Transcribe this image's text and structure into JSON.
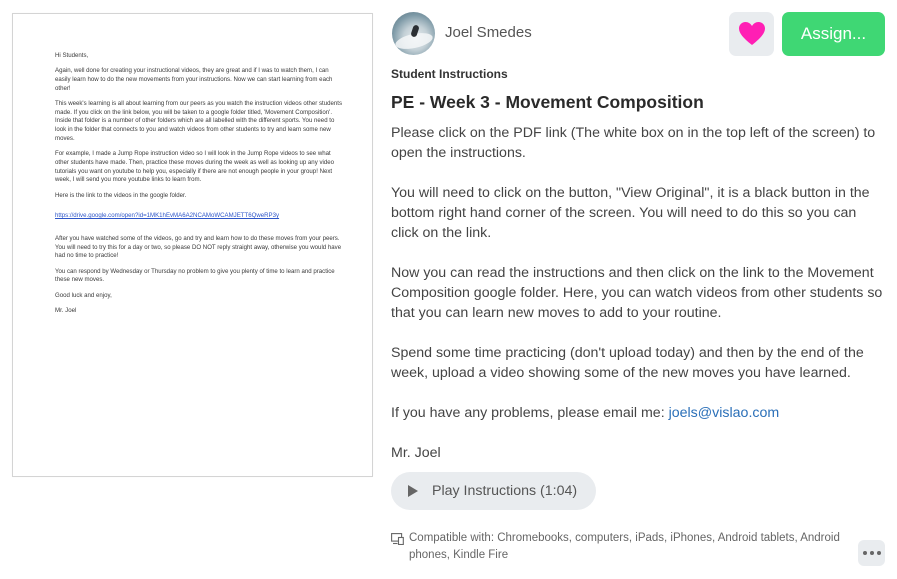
{
  "document": {
    "greeting": "Hi Students,",
    "paragraphs": [
      "Again, well done for creating your instructional videos, they are great and if I was to watch them, I can easily learn how to do the new movements from your instructions. Now we can start learning from each other!",
      "This week's learning is all about learning from our peers as you watch the instruction videos other students made. If you click on the link below, you will be taken to a google folder titled, 'Movement Composition'. Inside that folder is a number of other folders which are all labelled with the different sports. You need to look in the folder that connects to you and watch videos from other students to try and learn some new moves.",
      "For example, I made a Jump Rope instruction video so I will look in the Jump Rope videos to see what other students have made. Then, practice these moves during the week as well as looking up any video tutorials you want on youtube to help you, especially if there are not enough people in your group! Next week, I will send you more youtube links to learn from.",
      "Here is the link to the videos in the google folder."
    ],
    "link": "https://drive.google.com/open?id=1MK1hEvMA6A2NCAMoWCAMJETT6QweRP3y",
    "paragraphs_after": [
      "After you have watched some of the videos, go and try and learn how to do these moves from your peers. You will need to try this for a day or two, so please DO NOT reply straight away, otherwise you would have had no time to practice!",
      "You can respond by Wednesday or Thursday no problem to give you plenty of time to learn and practice these new moves.",
      "Good luck and enjoy,",
      "Mr. Joel"
    ]
  },
  "header": {
    "author_name": "Joel Smedes",
    "like_icon": "heart-icon",
    "like_color": "#ff1fb4",
    "assign_label": "Assign...",
    "assign_color": "#3fd774"
  },
  "instructions": {
    "section_label": "Student Instructions",
    "title": "PE - Week 3 - Movement Composition",
    "p1": "Please click on the PDF link (The white box on in the top left of the screen) to open the instructions.",
    "p2": "You will need to click on the button, \"View Original\", it is a black button in the bottom right hand corner of the screen. You will need to do this so you can click on the link.",
    "p3": "Now you can read the instructions and then click on the link to the Movement Composition google folder. Here, you can watch videos from other students so that you can learn new moves to add to your routine.",
    "p4": "Spend some time practicing (don't upload today) and then by the end of the week, upload a video showing some of the new moves you have learned.",
    "p5_prefix": "If you have any problems, please email me: ",
    "email": "joels@vislao.com",
    "signoff": "Mr. Joel"
  },
  "player": {
    "play_label": "Play Instructions (1:04)",
    "icon": "play-icon"
  },
  "footer": {
    "compat_text": "Compatible with: Chromebooks, computers, iPads, iPhones, Android tablets, Android phones, Kindle Fire",
    "device_icon": "devices-icon",
    "more_icon": "more-icon"
  }
}
